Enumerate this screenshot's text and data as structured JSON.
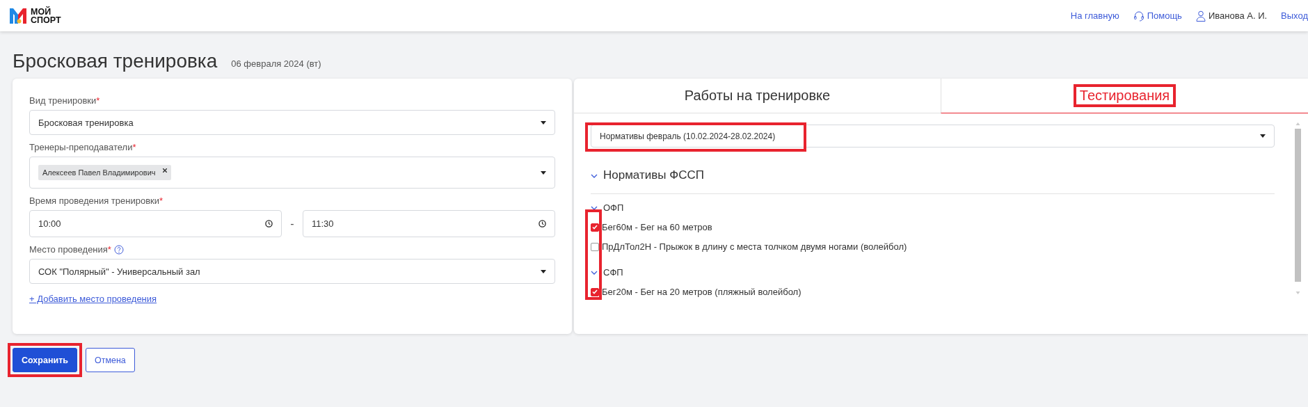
{
  "header": {
    "logo_lines": [
      "МОЙ",
      "СПОРТ"
    ],
    "nav": [
      {
        "kind": "link",
        "label": "На главную"
      },
      {
        "kind": "help",
        "label": "Помощь"
      },
      {
        "kind": "user",
        "label": "Иванова А. И."
      },
      {
        "kind": "link",
        "label": "Выход"
      }
    ]
  },
  "page": {
    "title": "Бросковая тренировка",
    "date": "06 февраля 2024 (вт)"
  },
  "form": {
    "fields": [
      {
        "kind": "select",
        "label": "Вид тренировки",
        "required_mark": "*",
        "value": "Бросковая тренировка"
      },
      {
        "kind": "tags",
        "label": "Тренеры-преподаватели",
        "required_mark": "*",
        "tags": [
          "Алексеев Павел Владимирович"
        ]
      },
      {
        "kind": "time",
        "label": "Время проведения тренировки",
        "required_mark": "*",
        "from": "10:00",
        "separator": "-",
        "to": "11:30"
      },
      {
        "kind": "select",
        "label": "Место проведения",
        "required_mark": "*",
        "help": true,
        "value": "СОК \"Полярный\" - Универсальный зал"
      }
    ],
    "add_link": "+ Добавить место проведения"
  },
  "tabs": [
    {
      "label": "Работы на тренировке",
      "selected": false,
      "highlighted": false
    },
    {
      "label": "Тестирования",
      "selected": true,
      "highlighted": true
    }
  ],
  "tests": {
    "select": {
      "value": "Нормативы февраль (10.02.2024-28.02.2024)",
      "highlighted": true
    },
    "checkboxes_highlighted": true,
    "tree": [
      {
        "label": "Нормативы ФССП",
        "expanded": true,
        "children": [
          {
            "label": "ОФП",
            "expanded": true,
            "children": [
              {
                "label": "Бег60м - Бег на 60 метров",
                "checked": true
              },
              {
                "label": "ПрДлТол2Н - Прыжок в длину с места толчком двумя ногами (волейбол)",
                "checked": false
              }
            ]
          },
          {
            "label": "СФП",
            "expanded": true,
            "children": [
              {
                "label": "Бег20м - Бег на 20 метров (пляжный волейбол)",
                "checked": true
              }
            ]
          }
        ]
      }
    ]
  },
  "buttons": [
    {
      "kind": "primary",
      "label": "Сохранить",
      "highlighted": true
    },
    {
      "kind": "outline",
      "label": "Отмена"
    }
  ]
}
